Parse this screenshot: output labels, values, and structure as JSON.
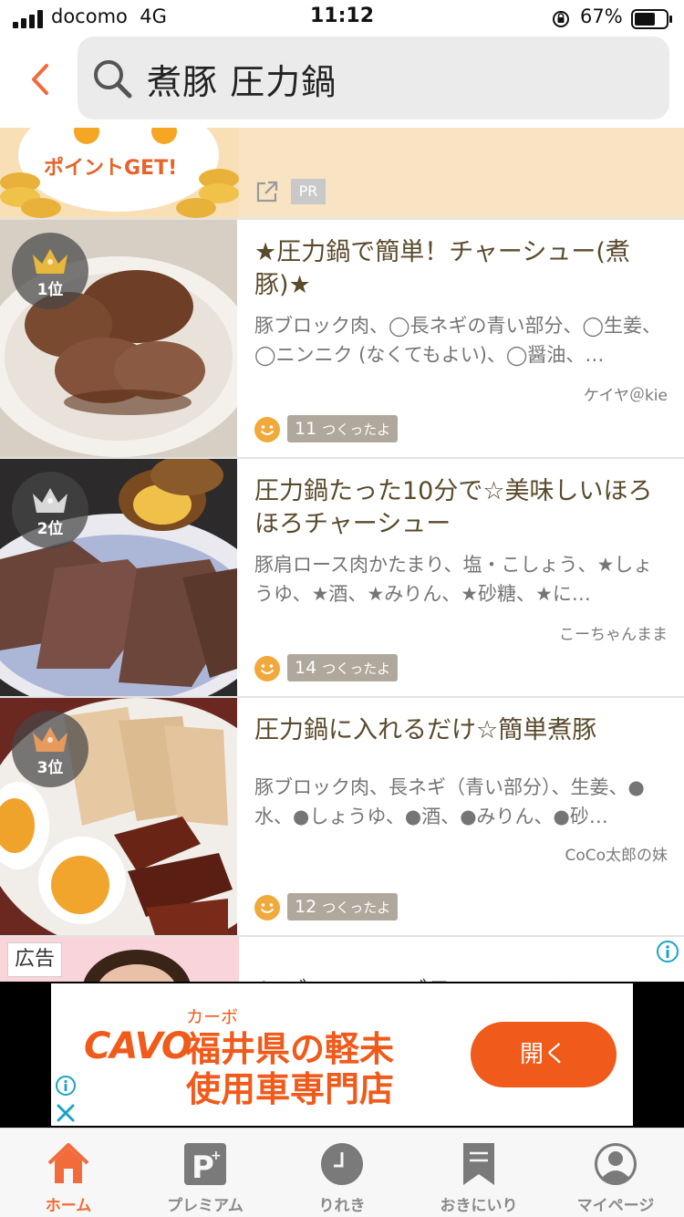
{
  "status_bar": {
    "carrier": "docomo",
    "network": "4G",
    "time": "11:12",
    "battery": "67%"
  },
  "search": {
    "query": "煮豚 圧力鍋"
  },
  "pr_card": {
    "promo_text": "ポイントGET!",
    "badge": "PR"
  },
  "recipes": [
    {
      "rank": "1位",
      "rank_color": "#e8b83c",
      "title": "★圧力鍋で簡単！チャーシュー(煮豚)★",
      "ingredients": "豚ブロック肉、◯長ネギの青い部分、◯生姜、◯ニンニク (なくてもよい)、◯醤油、…",
      "author": "ケイヤ＠kie",
      "tsukurepo_count": "11",
      "tsukurepo_label": "つくったよ"
    },
    {
      "rank": "2位",
      "rank_color": "#c8c8c8",
      "title": "圧力鍋たった10分で☆美味しいほろほろチャーシュー",
      "ingredients": "豚肩ロース肉かたまり、塩・こしょう、★しょうゆ、★酒、★みりん、★砂糖、★に…",
      "author": "こーちゃんまま",
      "tsukurepo_count": "14",
      "tsukurepo_label": "つくったよ"
    },
    {
      "rank": "3位",
      "rank_color": "#e89a5c",
      "title": "圧力鍋に入れるだけ☆簡単煮豚",
      "ingredients": "豚ブロック肉、長ネギ（青い部分）、生姜、●水、●しょうゆ、●酒、●みりん、●砂…",
      "author": "CoCo太郎の妹",
      "tsukurepo_count": "12",
      "tsukurepo_label": "つくったよ"
    }
  ],
  "ad_card": {
    "tag": "広告",
    "title": "レディースアデランスのステ…"
  },
  "banner": {
    "logo": "CAVO",
    "sub": "カーボ",
    "headline_line1": "福井県の軽未",
    "headline_line2": "使用車専門店",
    "button": "開く"
  },
  "tabbar": {
    "items": [
      {
        "label": "ホーム",
        "icon": "home-icon",
        "active": true
      },
      {
        "label": "プレミアム",
        "icon": "premium-icon",
        "active": false
      },
      {
        "label": "りれき",
        "icon": "history-icon",
        "active": false
      },
      {
        "label": "おきにいり",
        "icon": "bookmark-icon",
        "active": false
      },
      {
        "label": "マイページ",
        "icon": "profile-icon",
        "active": false
      }
    ]
  },
  "colors": {
    "accent": "#f26b3a",
    "banner_orange": "#f05a1a",
    "title_brown": "#5a4a2c"
  }
}
